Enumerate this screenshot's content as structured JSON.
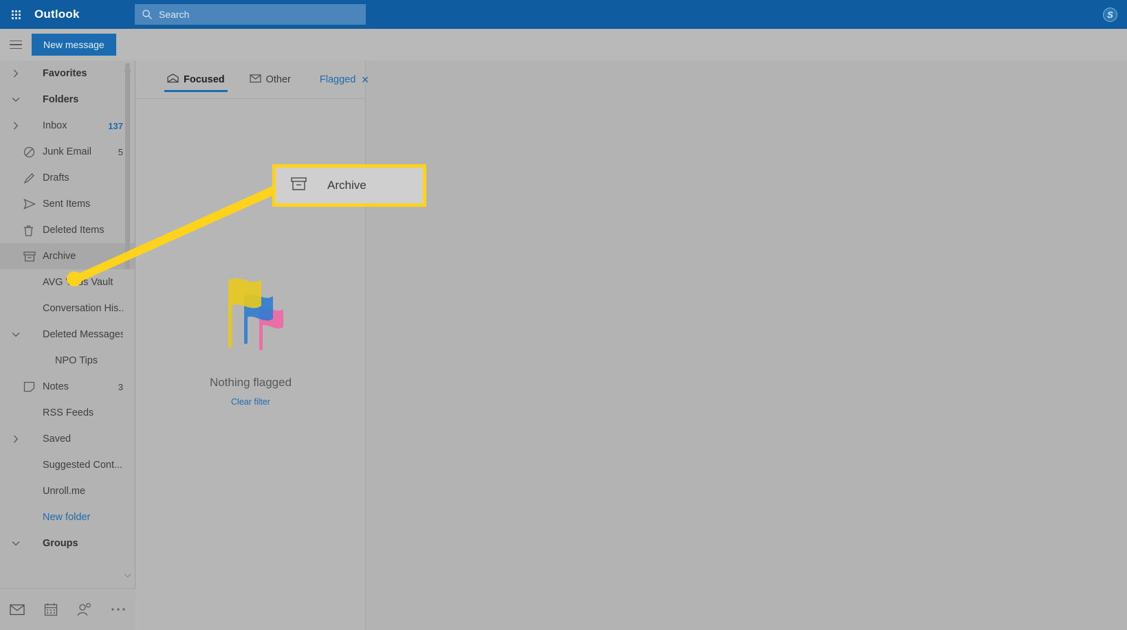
{
  "header": {
    "app_title": "Outlook",
    "waffle_icon": "app-launcher-grid-icon",
    "search_placeholder": "Search",
    "search_value": "",
    "search_icon": "search-icon",
    "skype_label": "S",
    "skype_icon": "skype-icon",
    "background_color": "#0f5ca0"
  },
  "command_bar": {
    "menu_icon": "hamburger-menu-icon",
    "new_message_label": "New message",
    "new_message_color": "#1a6bb0"
  },
  "sidebar": {
    "items": [
      {
        "label": "Favorites",
        "icon": "chevron-right-icon",
        "count": "",
        "type": "section",
        "expanded": false
      },
      {
        "label": "Folders",
        "icon": "chevron-down-icon",
        "count": "",
        "type": "section",
        "expanded": true
      },
      {
        "label": "Inbox",
        "icon": "chevron-right-icon",
        "count": "137",
        "type": "folder",
        "count_style": "blue"
      },
      {
        "label": "Junk Email",
        "icon": "block-icon",
        "count": "5",
        "type": "folder"
      },
      {
        "label": "Drafts",
        "icon": "pencil-icon",
        "count": "",
        "type": "folder"
      },
      {
        "label": "Sent Items",
        "icon": "send-icon",
        "count": "",
        "type": "folder"
      },
      {
        "label": "Deleted Items",
        "icon": "trash-icon",
        "count": "",
        "type": "folder"
      },
      {
        "label": "Archive",
        "icon": "archive-box-icon",
        "count": "",
        "type": "folder",
        "selected": true
      },
      {
        "label": "AVG Virus Vault",
        "icon": "",
        "count": "",
        "type": "folder"
      },
      {
        "label": "Conversation His...",
        "icon": "",
        "count": "",
        "type": "folder"
      },
      {
        "label": "Deleted Messages",
        "icon": "chevron-down-icon",
        "count": "",
        "type": "folder",
        "expanded": true
      },
      {
        "label": "NPO Tips",
        "icon": "",
        "count": "",
        "type": "subfolder"
      },
      {
        "label": "Notes",
        "icon": "note-icon",
        "count": "3",
        "type": "folder"
      },
      {
        "label": "RSS Feeds",
        "icon": "",
        "count": "",
        "type": "folder"
      },
      {
        "label": "Saved",
        "icon": "chevron-right-icon",
        "count": "",
        "type": "folder"
      },
      {
        "label": "Suggested Cont...",
        "icon": "",
        "count": "",
        "type": "folder"
      },
      {
        "label": "Unroll.me",
        "icon": "",
        "count": "",
        "type": "folder"
      },
      {
        "label": "New folder",
        "icon": "",
        "count": "",
        "type": "link"
      },
      {
        "label": "Groups",
        "icon": "chevron-down-icon",
        "count": "",
        "type": "section",
        "expanded": true
      }
    ],
    "app_nav": [
      {
        "name": "mail-icon",
        "label": "Mail"
      },
      {
        "name": "calendar-icon",
        "label": "Calendar"
      },
      {
        "name": "people-icon",
        "label": "People"
      },
      {
        "name": "more-options-icon",
        "label": "More"
      }
    ]
  },
  "message_list": {
    "tabs": [
      {
        "label": "Focused",
        "icon": "focused-inbox-icon",
        "active": true
      },
      {
        "label": "Other",
        "icon": "other-inbox-icon",
        "active": false
      }
    ],
    "filter_chip": {
      "label": "Flagged",
      "close_icon": "close-icon"
    },
    "empty_state": {
      "illustration": "three-flags-icon",
      "title": "Nothing flagged",
      "link_label": "Clear filter",
      "flag_colors": [
        "#e8c91f",
        "#2b7cd3",
        "#ea6fa4"
      ]
    }
  },
  "callout": {
    "label": "Archive",
    "icon": "archive-box-icon",
    "border_color": "#ffd21c",
    "background_color": "#cfcfcf",
    "pointer_color": "#ffd21c"
  }
}
